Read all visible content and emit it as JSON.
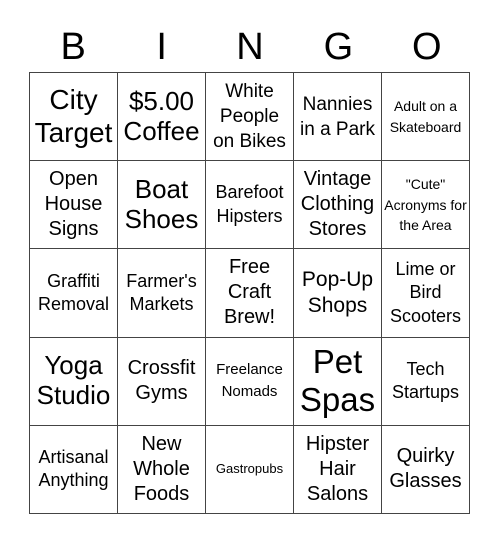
{
  "header": {
    "letters": [
      "B",
      "I",
      "N",
      "G",
      "O"
    ]
  },
  "grid": {
    "rows": [
      [
        "City Target",
        "$5.00 Coffee",
        "White People on Bikes",
        "Nannies in a Park",
        "Adult on a Skateboard"
      ],
      [
        "Open House Signs",
        "Boat Shoes",
        "Barefoot Hipsters",
        "Vintage Clothing Stores",
        "\"Cute\" Acronyms for the Area"
      ],
      [
        "Graffiti Removal",
        "Farmer's Markets",
        "Free Craft Brew!",
        "Pop-Up Shops",
        "Lime or Bird Scooters"
      ],
      [
        "Yoga Studio",
        "Crossfit Gyms",
        "Freelance Nomads",
        "Pet Spas",
        "Tech Startups"
      ],
      [
        "Artisanal Anything",
        "New Whole Foods",
        "Gastropubs",
        "Hipster Hair Salons",
        "Quirky Glasses"
      ]
    ]
  }
}
